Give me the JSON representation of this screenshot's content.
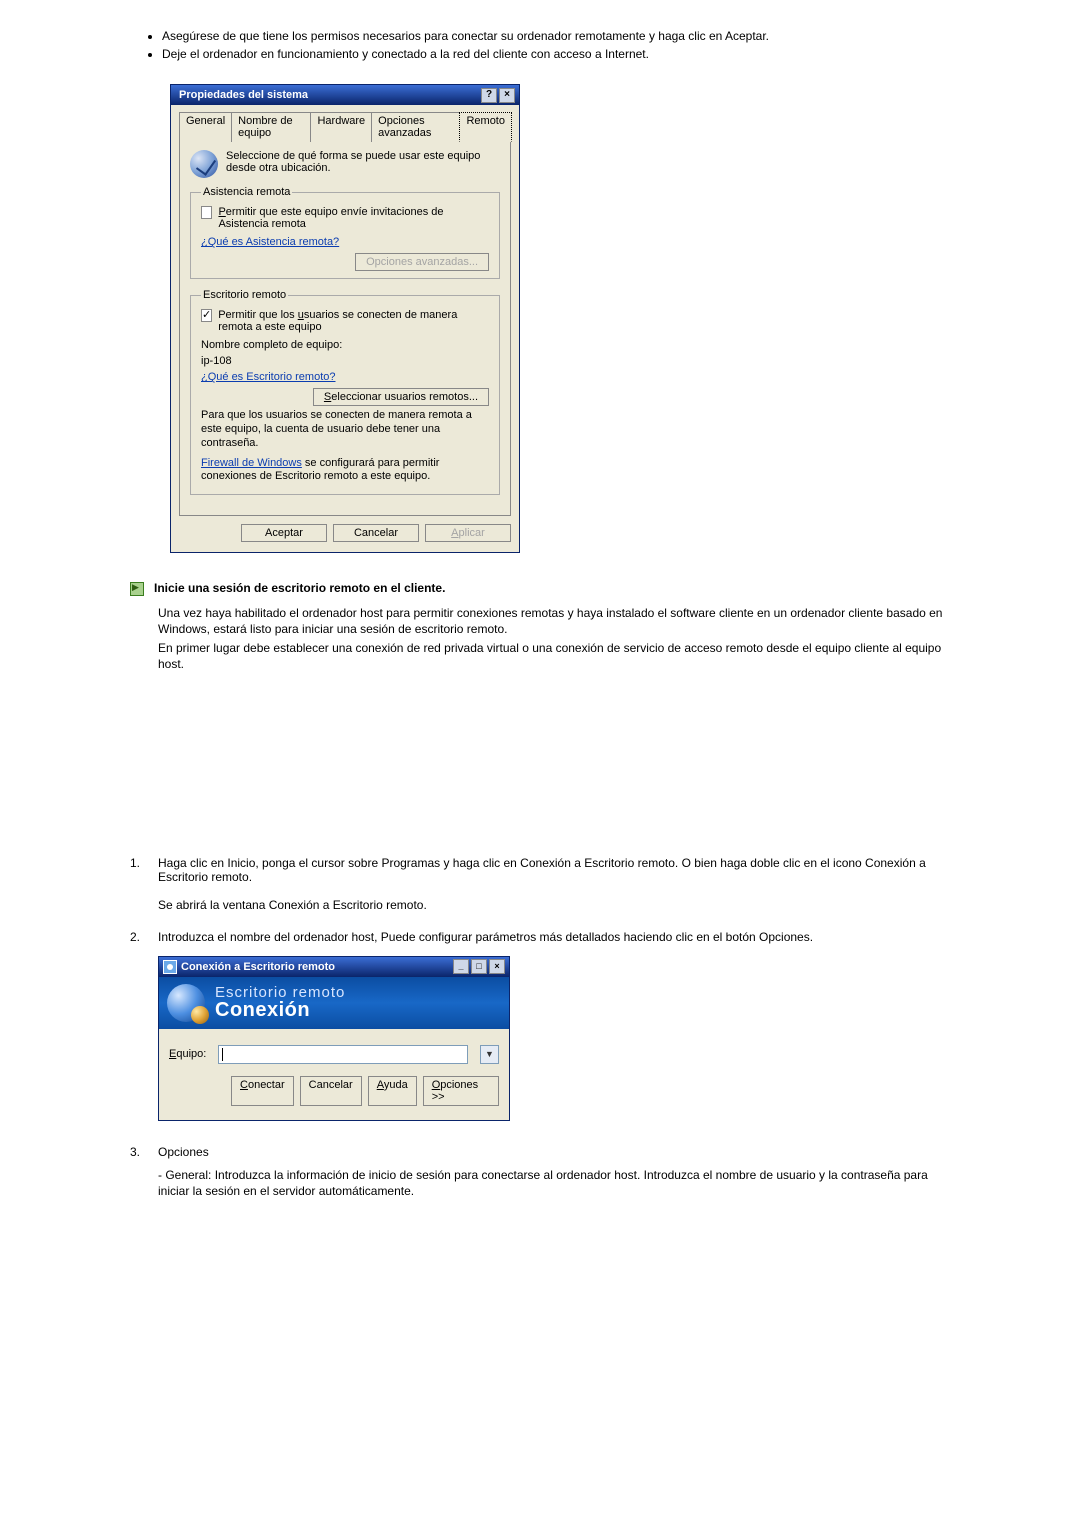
{
  "intro_list": [
    "Asegúrese de que tiene los permisos necesarios para conectar su ordenador remotamente y haga clic en Aceptar.",
    "Deje el ordenador en funcionamiento y conectado a la red del cliente con acceso a Internet."
  ],
  "sysprop": {
    "title": "Propiedades del sistema",
    "tabs": {
      "general": "General",
      "computer_name": "Nombre de equipo",
      "hardware": "Hardware",
      "advanced": "Opciones avanzadas",
      "remote": "Remoto"
    },
    "intro": "Seleccione de qué forma se puede usar este equipo desde otra ubicación.",
    "ra": {
      "legend": "Asistencia remota",
      "chk_P": "P",
      "chk_rest": "ermitir que este equipo envíe invitaciones de Asistencia remota",
      "link": "¿Qué es Asistencia remota?",
      "adv_btn": "Opciones avanzadas..."
    },
    "rd": {
      "legend": "Escritorio remoto",
      "chk_before": "Permitir que los ",
      "chk_u": "u",
      "chk_after": "suarios se conecten de manera remota a este equipo",
      "name_label": "Nombre completo de equipo:",
      "name_value": "ip-108",
      "link": "¿Qué es Escritorio remoto?",
      "sel_S": "S",
      "sel_rest": "eleccionar usuarios remotos...",
      "note1": "Para que los usuarios se conecten de manera remota a este equipo, la cuenta de usuario debe tener una contraseña.",
      "note2a": "Firewall de Windows",
      "note2b": " se configurará para permitir conexiones de Escritorio remoto a este equipo."
    },
    "buttons": {
      "ok": "Aceptar",
      "cancel": "Cancelar",
      "apply_A": "A",
      "apply_rest": "plicar"
    }
  },
  "section2": {
    "heading": "Inicie una sesión de escritorio remoto en el cliente.",
    "p1": "Una vez haya habilitado el ordenador host para permitir conexiones remotas y haya instalado el software cliente en un ordenador cliente basado en Windows, estará listo para iniciar una sesión de escritorio remoto.",
    "p2": "En primer lugar debe establecer una conexión de red privada virtual o una conexión de servicio de acceso remoto desde el equipo cliente al equipo host."
  },
  "steps": {
    "s1": {
      "num": "1.",
      "a": "Haga clic en Inicio, ponga el cursor sobre Programas y haga clic en Conexión a Escritorio remoto. O bien haga doble clic en el icono Conexión a Escritorio remoto.",
      "b": "Se abrirá la ventana Conexión a Escritorio remoto."
    },
    "s2": {
      "num": "2.",
      "text": "Introduzca el nombre del ordenador host, Puede configurar parámetros más detallados haciendo clic en el botón Opciones."
    },
    "s3": {
      "num": "3.",
      "text": "Opciones",
      "sub": "- General: Introduzca la información de inicio de sesión para conectarse al ordenador host. Introduzca el nombre de usuario y la contraseña para iniciar la sesión en el servidor automáticamente."
    }
  },
  "rdp": {
    "title": "Conexión a Escritorio remoto",
    "banner1": "Escritorio remoto",
    "banner2": "Conexión",
    "equipo_E": "E",
    "equipo_rest": "quipo:",
    "connect_C": "C",
    "connect_rest": "onectar",
    "cancel": "Cancelar",
    "help_A": "A",
    "help_rest": "yuda",
    "opts_O": "O",
    "opts_rest": "pciones >>"
  }
}
